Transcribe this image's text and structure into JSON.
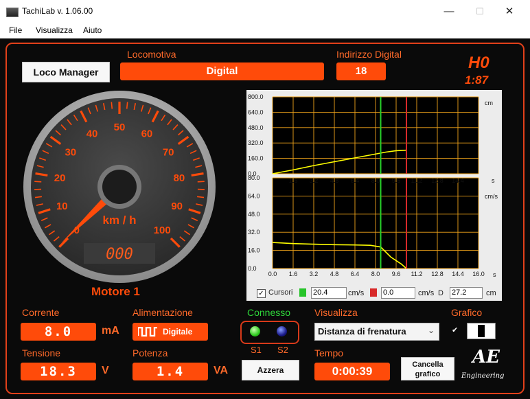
{
  "window": {
    "title": "TachiLab v. 1.06.00",
    "minimize": "—",
    "maximize": "☐",
    "close": "✕"
  },
  "menu": [
    "File",
    "Visualizza",
    "Aiuto"
  ],
  "header": {
    "loco_manager_label": "Loco Manager",
    "locomotiva_label": "Locomotiva",
    "locomotiva_value": "Digital",
    "indirizzo_label": "Indirizzo Digital",
    "indirizzo_value": "18",
    "scale_top": "H0",
    "scale_bottom": "1:87"
  },
  "speedometer": {
    "unit": "km / h",
    "display": "000",
    "ticks": [
      "0",
      "10",
      "20",
      "30",
      "40",
      "50",
      "60",
      "70",
      "80",
      "90",
      "100"
    ],
    "value": 0,
    "motor_label": "Motore 1"
  },
  "chart_data": [
    {
      "type": "line",
      "x_unit": "s",
      "y_unit": "cm",
      "ylim": [
        0,
        800
      ],
      "y_ticks": [
        "800.0",
        "640.0",
        "480.0",
        "320.0",
        "160.0",
        "0.0"
      ],
      "x_ticks": [
        "1.6",
        "3.2",
        "4.8",
        "6.4",
        "8.0",
        "9.6",
        "11.2",
        "12.8",
        "14.4"
      ],
      "xlim": [
        0,
        16
      ],
      "series": [
        {
          "x": [
            0,
            1.6,
            3.2,
            4.8,
            6.4,
            7.8,
            8.8,
            9.6,
            10.4
          ],
          "y": [
            0,
            40,
            85,
            125,
            165,
            200,
            225,
            240,
            245
          ]
        }
      ],
      "cursor_green": 8.4,
      "cursor_red": 10.4
    },
    {
      "type": "line",
      "x_unit": "s",
      "y_unit": "cm/s",
      "ylim": [
        0,
        80
      ],
      "y_ticks": [
        "80.0",
        "64.0",
        "48.0",
        "32.0",
        "16.0",
        "0.0"
      ],
      "x_ticks": [
        "0.0",
        "1.6",
        "3.2",
        "4.8",
        "6.4",
        "8.0",
        "9.6",
        "11.2",
        "12.8",
        "14.4",
        "16.0"
      ],
      "xlim": [
        0,
        16
      ],
      "series": [
        {
          "x": [
            0,
            1.6,
            3.2,
            4.8,
            6.4,
            7.6,
            8.4,
            9.2,
            10.0,
            10.4
          ],
          "y": [
            23,
            22,
            21.5,
            21,
            20.8,
            20.5,
            19,
            10,
            4,
            0
          ]
        }
      ],
      "cursor_green": 8.4,
      "cursor_red": 10.4
    }
  ],
  "cursors": {
    "label": "Cursori",
    "green_value": "20.4",
    "green_unit": "cm/s",
    "red_value": "0.0",
    "red_unit": "cm/s",
    "d_label": "D",
    "d_value": "27.2",
    "d_unit": "cm"
  },
  "corrente": {
    "label": "Corrente",
    "value": "8.0",
    "unit": "mA"
  },
  "tensione": {
    "label": "Tensione",
    "value": "18.3",
    "unit": "V"
  },
  "alimentazione": {
    "label": "Alimentazione",
    "value": "Digitale"
  },
  "potenza": {
    "label": "Potenza",
    "value": "1.4",
    "unit": "VA"
  },
  "connesso": {
    "label": "Connesso",
    "s1": "S1",
    "s2": "S2",
    "azzera": "Azzera"
  },
  "visualizza": {
    "label": "Visualizza",
    "selected": "Distanza di frenatura"
  },
  "tempo": {
    "label": "Tempo",
    "value": "0:00:39"
  },
  "grafico": {
    "label": "Grafico",
    "checkmark": "✔"
  },
  "cancella": {
    "line1": "Cancella",
    "line2": "grafico"
  },
  "logo": {
    "mark": "AE",
    "text": "Engineering"
  },
  "colors": {
    "accent": "#ff4b0a",
    "panel": "#0a0a0a",
    "green_cursor": "#27d22a",
    "red_cursor": "#d8282a",
    "series": "#ffff00",
    "grid": "#f2a51a"
  }
}
